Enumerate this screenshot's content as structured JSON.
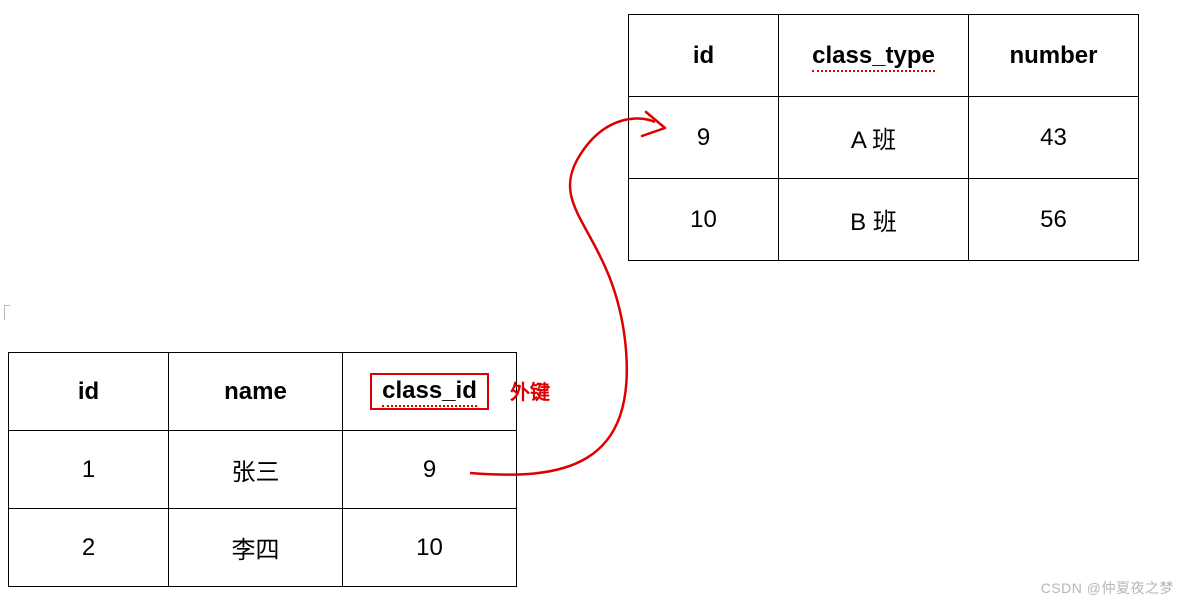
{
  "classTable": {
    "headers": {
      "id": "id",
      "class_type": "class_type",
      "number": "number"
    },
    "rows": [
      {
        "id": "9",
        "class_type": "A 班",
        "number": "43"
      },
      {
        "id": "10",
        "class_type": "B 班",
        "number": "56"
      }
    ]
  },
  "studentTable": {
    "headers": {
      "id": "id",
      "name": "name",
      "class_id": "class_id"
    },
    "rows": [
      {
        "id": "1",
        "name": "张三",
        "class_id": "9"
      },
      {
        "id": "2",
        "name": "李四",
        "class_id": "10"
      }
    ]
  },
  "annotations": {
    "fk_label": "外键"
  },
  "watermark": "CSDN @仲夏夜之梦"
}
